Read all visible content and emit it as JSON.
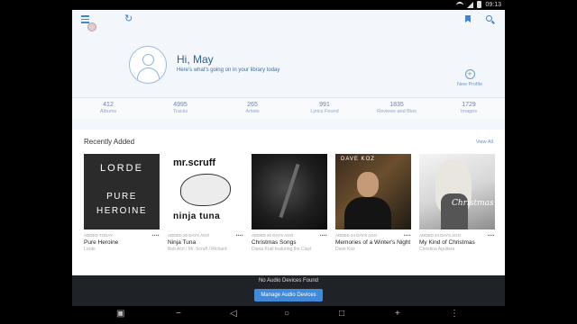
{
  "statusbar": {
    "time": "09:13"
  },
  "toolbar": {
    "menu_icon": "hamburger-icon",
    "refresh_icon": "refresh-icon",
    "bookmark_icon": "bookmark-icon",
    "search_icon": "search-icon",
    "accent_color": "#3d85d6"
  },
  "profile": {
    "greeting": "Hi, May",
    "subtitle": "Here's what's going on in your library today",
    "new_profile_label": "New Profile",
    "plus_glyph": "+"
  },
  "stats": [
    {
      "value": "412",
      "label": "Albums"
    },
    {
      "value": "4995",
      "label": "Tracks"
    },
    {
      "value": "265",
      "label": "Artists"
    },
    {
      "value": "991",
      "label": "Lyrics Found"
    },
    {
      "value": "1835",
      "label": "Reviews and Bios"
    },
    {
      "value": "1729",
      "label": "Images"
    }
  ],
  "recent": {
    "title": "Recently Added",
    "view_all": "View All",
    "albums": [
      {
        "added": "ADDED TODAY",
        "title": "Pure Heroine",
        "artist": "Lorde",
        "cover_lines": [
          "LORDE",
          "PURE",
          "HEROINE"
        ]
      },
      {
        "added": "ADDED 20 DAYS AGO",
        "title": "Ninja Tuna",
        "artist": "Bob Acri / Mr. Scruff / Richard",
        "cover_lines": [
          "mr.scruff",
          "ninja tuna"
        ]
      },
      {
        "added": "ADDED 20 DAYS AGO",
        "title": "Christmas Songs",
        "artist": "Diana Krall featuring the Clayt",
        "cover_lines": []
      },
      {
        "added": "ADDED 24 DAYS AGO",
        "title": "Memories of a Winter's Night",
        "artist": "Dave Koz",
        "cover_lines": [
          "DAVE KOZ"
        ]
      },
      {
        "added": "ADDED 24 DAYS AGO",
        "title": "My Kind of Christmas",
        "artist": "Christina Aguilera",
        "cover_lines": [
          "Christmas"
        ]
      }
    ]
  },
  "devices": {
    "message": "No Audio Devices Found",
    "button": "Manage Audio Devices",
    "button_color": "#3f8ad9"
  },
  "navbar": {
    "screenshot_icon": "screenshot-icon",
    "volume_down_icon": "volume-down-icon",
    "back_icon": "back-icon",
    "home_icon": "home-icon",
    "recents_icon": "recents-icon",
    "volume_up_icon": "volume-up-icon",
    "more_icon": "more-icon"
  }
}
